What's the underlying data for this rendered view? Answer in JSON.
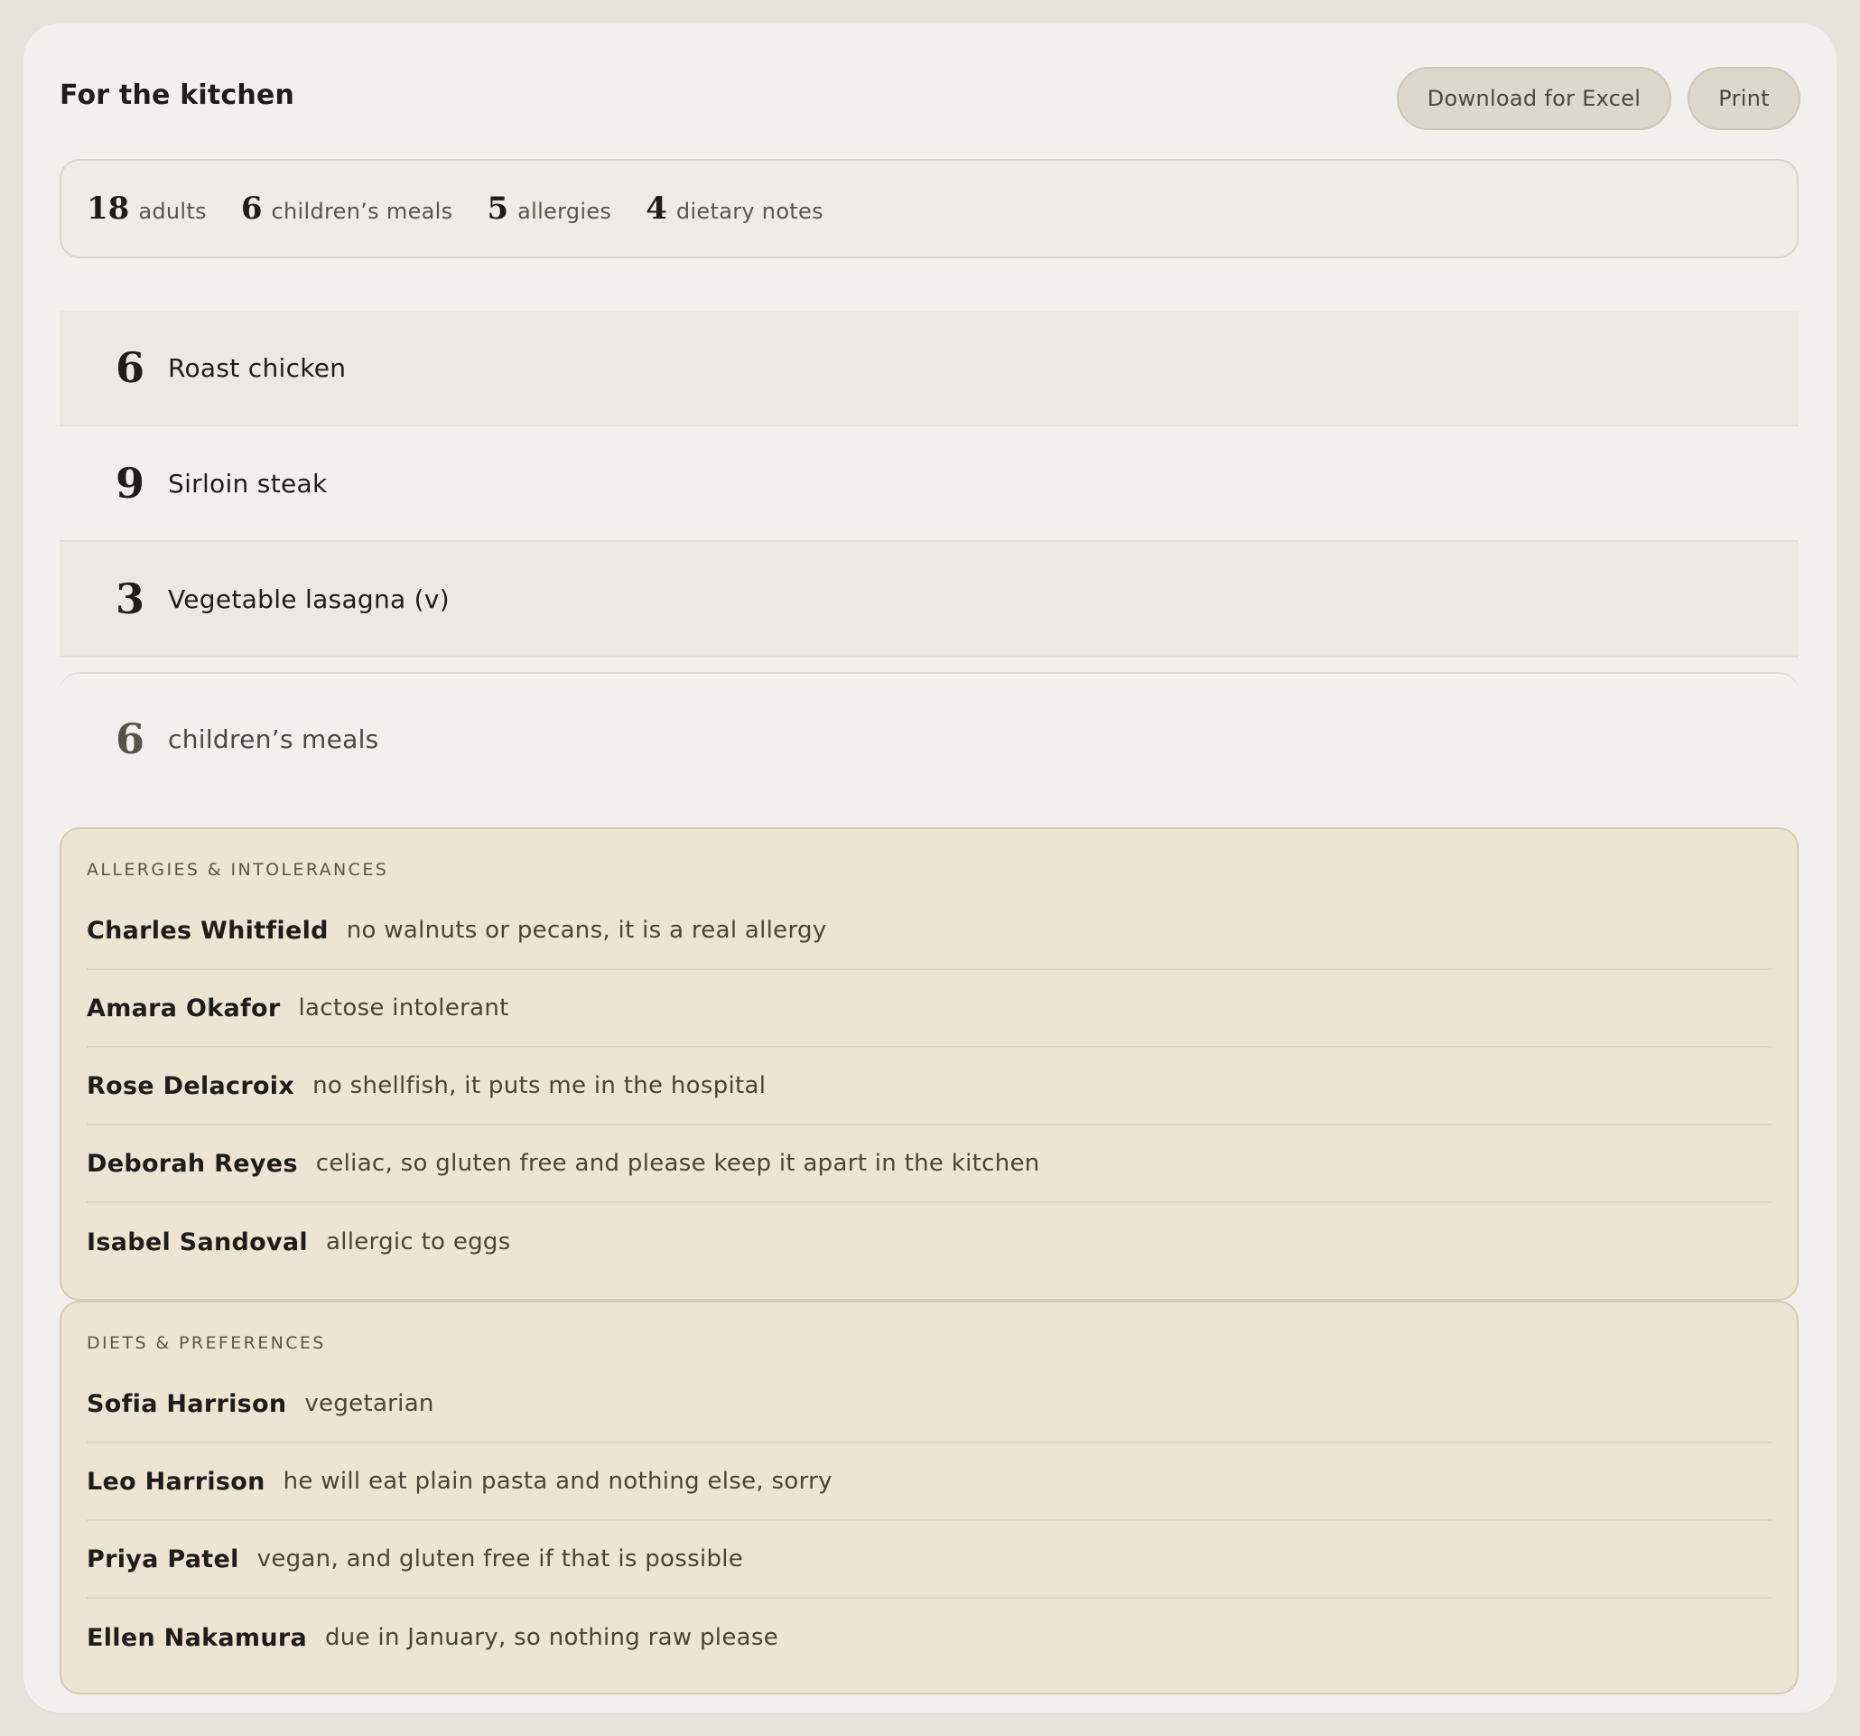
{
  "header": {
    "title": "For the kitchen",
    "download_label": "Download for Excel",
    "print_label": "Print"
  },
  "stats": [
    {
      "value": "18",
      "label": "adults"
    },
    {
      "value": "6",
      "label": "children’s meals"
    },
    {
      "value": "5",
      "label": "allergies"
    },
    {
      "value": "4",
      "label": "dietary notes"
    }
  ],
  "dishes": [
    {
      "count": "6",
      "name": "Roast chicken"
    },
    {
      "count": "9",
      "name": "Sirloin steak"
    },
    {
      "count": "3",
      "name": "Vegetable lasagna (v)"
    }
  ],
  "children": {
    "count": "6",
    "label": "children’s meals"
  },
  "allergies": {
    "title": "ALLERGIES & INTOLERANCES",
    "items": [
      {
        "name": "Charles Whitfield",
        "note": "no walnuts or pecans, it is a real allergy"
      },
      {
        "name": "Amara Okafor",
        "note": "lactose intolerant"
      },
      {
        "name": "Rose Delacroix",
        "note": "no shellfish, it puts me in the hospital"
      },
      {
        "name": "Deborah Reyes",
        "note": "celiac, so gluten free and please keep it apart in the kitchen"
      },
      {
        "name": "Isabel Sandoval",
        "note": "allergic to eggs"
      }
    ]
  },
  "diets": {
    "title": "DIETS & PREFERENCES",
    "items": [
      {
        "name": "Sofia Harrison",
        "note": "vegetarian"
      },
      {
        "name": "Leo Harrison",
        "note": "he will eat plain pasta and nothing else, sorry"
      },
      {
        "name": "Priya Patel",
        "note": "vegan, and gluten free if that is possible"
      },
      {
        "name": "Ellen Nakamura",
        "note": "due in January, so nothing raw please"
      }
    ]
  }
}
